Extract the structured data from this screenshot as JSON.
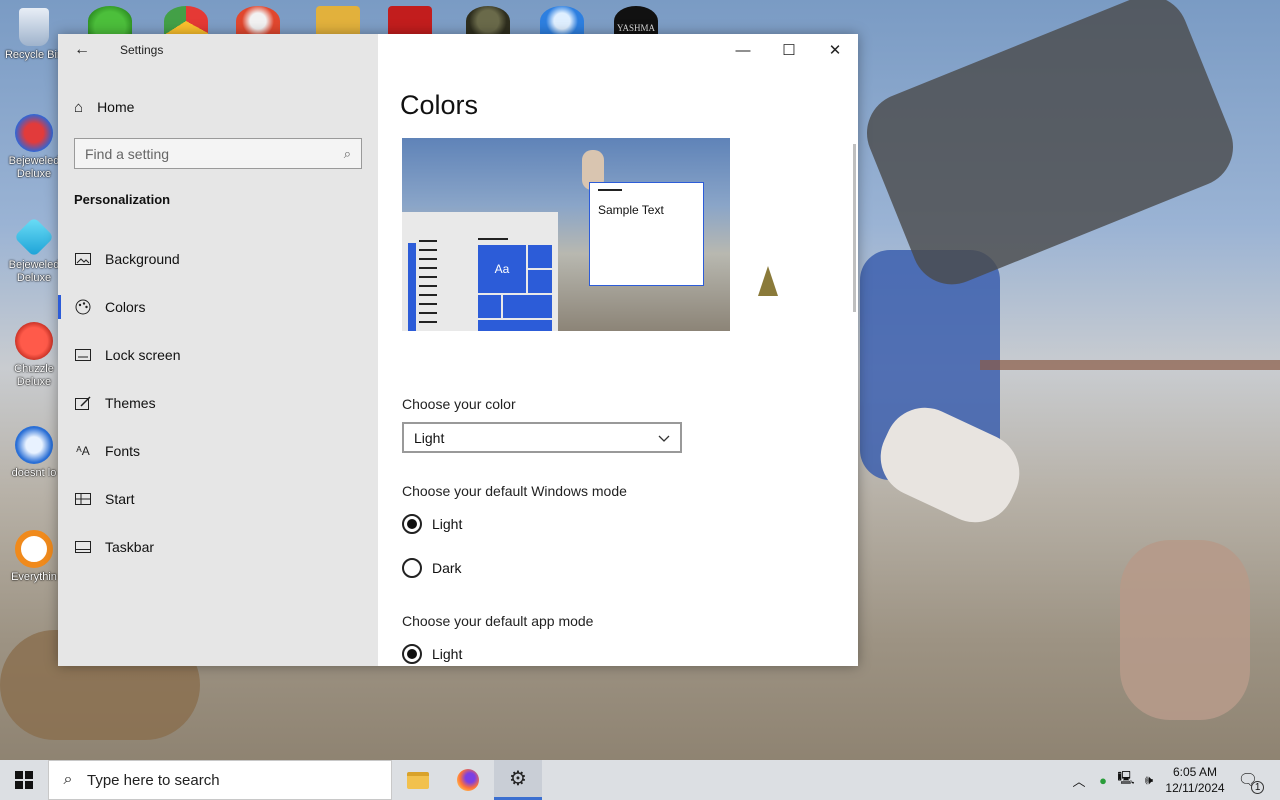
{
  "desktop": {
    "icons": [
      {
        "label": "Recycle Bin",
        "icon": "recycle-bin-icon"
      },
      {
        "label": "Bejeweled Deluxe",
        "icon": "bejeweled-2-icon"
      },
      {
        "label": "Bejeweled Deluxe",
        "icon": "bejeweled-icon"
      },
      {
        "label": "Chuzzle Deluxe",
        "icon": "chuzzle-icon"
      },
      {
        "label": "doesnt lo",
        "icon": "thunderbird-icon"
      },
      {
        "label": "Everythin",
        "icon": "everything-search-icon"
      }
    ],
    "top_label": "YASHMA"
  },
  "window": {
    "app_title": "Settings",
    "controls": {
      "minimize": "—",
      "maximize": "☐",
      "close": "✕"
    }
  },
  "sidebar": {
    "home": "Home",
    "search_placeholder": "Find a setting",
    "section": "Personalization",
    "items": [
      {
        "label": "Background",
        "icon": "image-icon"
      },
      {
        "label": "Colors",
        "icon": "palette-icon",
        "selected": true
      },
      {
        "label": "Lock screen",
        "icon": "lock-screen-icon"
      },
      {
        "label": "Themes",
        "icon": "themes-icon"
      },
      {
        "label": "Fonts",
        "icon": "fonts-icon"
      },
      {
        "label": "Start",
        "icon": "start-icon"
      },
      {
        "label": "Taskbar",
        "icon": "taskbar-icon"
      }
    ]
  },
  "main": {
    "title": "Colors",
    "preview": {
      "tile_text": "Aa",
      "sample_text": "Sample Text",
      "accent": "#2c5cd8"
    },
    "choose_color_label": "Choose your color",
    "choose_color_value": "Light",
    "windows_mode": {
      "label": "Choose your default Windows mode",
      "options": [
        "Light",
        "Dark"
      ],
      "selected": "Light"
    },
    "app_mode": {
      "label": "Choose your default app mode",
      "options": [
        "Light"
      ],
      "selected": "Light"
    }
  },
  "taskbar": {
    "search_placeholder": "Type here to search",
    "apps": [
      "file-explorer-icon",
      "firefox-icon",
      "settings-icon"
    ],
    "clock_time": "6:05 AM",
    "clock_date": "12/11/2024",
    "notification_count": "1"
  }
}
